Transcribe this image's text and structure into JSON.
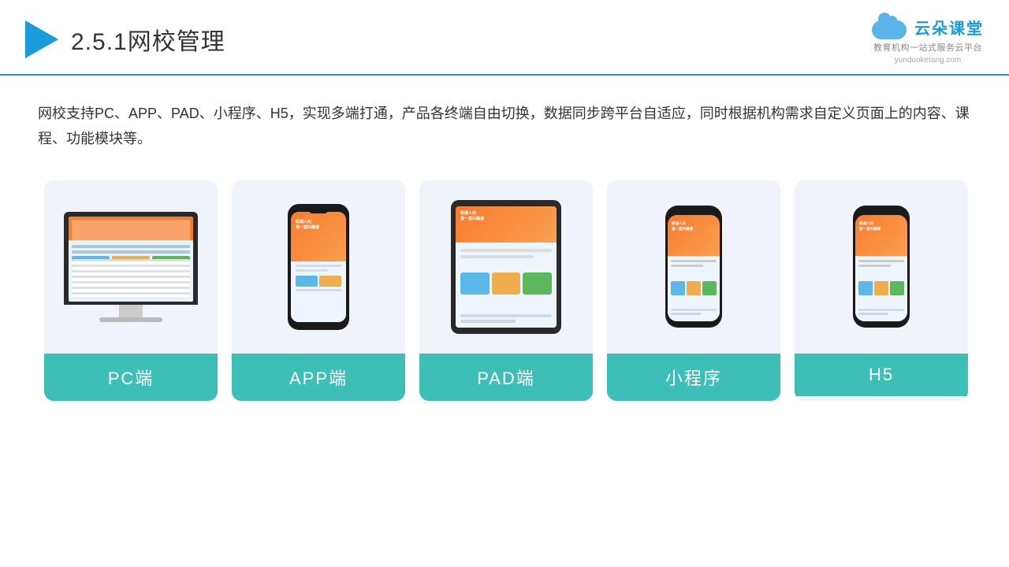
{
  "header": {
    "title_prefix": "2.5.1",
    "title_main": "网校管理"
  },
  "logo": {
    "brand": "云朵课堂",
    "url": "yunduoketang.com",
    "tagline1": "教育机构一站",
    "tagline2": "式服务云平台"
  },
  "description": "网校支持PC、APP、PAD、小程序、H5，实现多端打通，产品各终端自由切换，数据同步跨平台自适应，同时根据机构需求自定义页面上的内容、课程、功能模块等。",
  "cards": [
    {
      "label": "PC端",
      "type": "pc"
    },
    {
      "label": "APP端",
      "type": "phone"
    },
    {
      "label": "PAD端",
      "type": "tablet"
    },
    {
      "label": "小程序",
      "type": "mini-phone"
    },
    {
      "label": "H5",
      "type": "mini-phone2"
    }
  ],
  "accent_color": "#3dbfb8"
}
